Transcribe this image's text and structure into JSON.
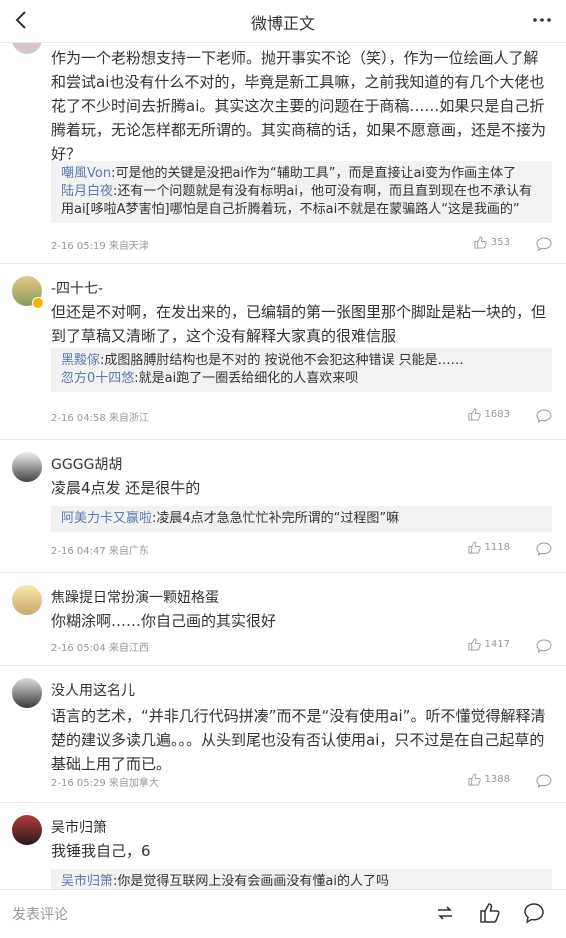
{
  "header": {
    "title": "微博正文"
  },
  "comments": [
    {
      "text": "作为一个老粉想支持一下老师。抛开事实不论（笑），作为一位绘画人了解和尝试ai也没有什么不对的，毕竟是新工具嘛，之前我知道的有几个大佬也花了不少时间去折腾ai。其实这次主要的问题在于商稿……如果只是自己折腾着玩，无论怎样都无所谓的。其实商稿的话，如果不愿意画，还是不接为好？",
      "replies": [
        {
          "user": "嘲風Von",
          "text": ":可是他的关键是没把ai作为“辅助工具”，而是直接让ai变为作画主体了"
        },
        {
          "user": "陆月白夜",
          "text": ":还有一个问题就是有没有标明ai，他可没有啊，而且直到现在也不承认有用ai[哆啦A梦害怕]哪怕是自己折腾着玩，不标ai不就是在蒙骗路人“这是我画的”"
        }
      ],
      "meta": "2-16 05:19 来自天津",
      "likes": "353"
    },
    {
      "user": "-四十七-",
      "text": "但还是不对啊，在发出来的，已编辑的第一张图里那个脚趾是粘一块的，但到了草稿又清晰了，这个没有解释大家真的很难信服",
      "replies": [
        {
          "user": "黑黢傢",
          "text": ":成图胳膊肘结构也是不对的 按说他不会犯这种错误 只能是……"
        },
        {
          "user": "忽方0十四悠",
          "text": ":就是ai跑了一圈丢给细化的人喜欢来呗"
        }
      ],
      "meta": "2-16 04:58 来自浙江",
      "likes": "1683"
    },
    {
      "user": "GGGG胡胡",
      "text": "凌晨4点发 还是很牛的",
      "replies": [
        {
          "user": "阿美力卡又赢啦",
          "text": ":凌晨4点才急急忙忙补完所谓的“过程图”嘛"
        }
      ],
      "meta": "2-16 04:47 来自广东",
      "likes": "1118"
    },
    {
      "user": "焦躁提日常扮演一颗妞格蛋",
      "text": "你糊涂啊……你自己画的其实很好",
      "meta": "2-16 05:04 来自江西",
      "likes": "1417"
    },
    {
      "user": "没人用这名儿",
      "text": "语言的艺术，“并非几行代码拼凑”而不是“没有使用ai”。听不懂觉得解释清楚的建议多读几遍。。。从头到尾也没有否认使用ai，只不过是在自己起草的基础上用了而已。",
      "meta": "2-16 05:29 来自加拿大",
      "likes": "1388"
    },
    {
      "user": "吴市归箫",
      "text": "我锤我自己，6",
      "replies": [
        {
          "user": "吴市归箫",
          "text": ":你是觉得互联网上没有会画画没有懂ai的人了吗"
        }
      ]
    }
  ],
  "footer": {
    "input_placeholder": "发表评论"
  },
  "colors": {
    "link": "#5a7ab1",
    "reply_bg": "#f2f2f2",
    "meta": "#999999"
  }
}
